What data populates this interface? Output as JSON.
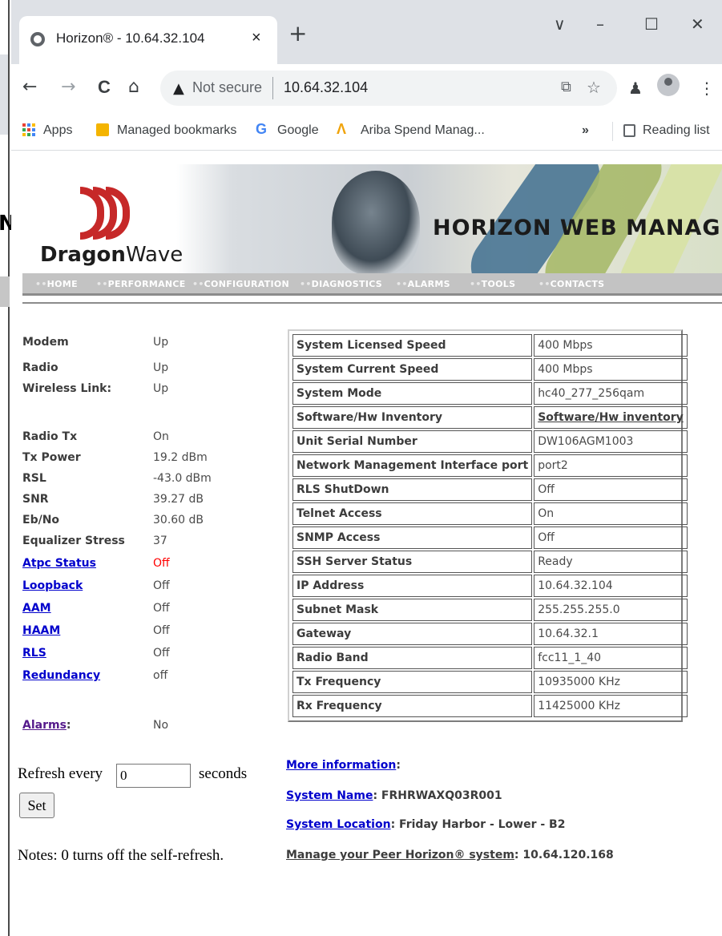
{
  "browser": {
    "tab_title": "Horizon® - 10.64.32.104",
    "tab_close": "×",
    "new_tab": "+",
    "window_controls": {
      "dropdown": "∨",
      "minimize": "–",
      "maximize": "☐",
      "close": "✕"
    },
    "nav": {
      "back": "←",
      "forward": "→",
      "reload": "C",
      "home": "⌂"
    },
    "omnibox": {
      "security_label": "Not secure",
      "url": "10.64.32.104"
    },
    "toolbar_icons": {
      "share": "⧉",
      "star": "☆",
      "extensions": "♟",
      "menu": "⋮"
    },
    "bookmarks": {
      "apps": "Apps",
      "managed": "Managed bookmarks",
      "google": "Google",
      "ariba": "Ariba Spend Manag...",
      "overflow": "»",
      "reading_list": "Reading list"
    }
  },
  "banner": {
    "logo_bold": "Dragon",
    "logo_light": "Wave",
    "title": "HORIZON WEB MANAGE"
  },
  "menu": [
    "HOME",
    "PERFORMANCE",
    "CONFIGURATION",
    "DIAGNOSTICS",
    "ALARMS",
    "TOOLS",
    "CONTACTS"
  ],
  "status": {
    "rows": [
      {
        "label": "Modem",
        "value": "Up"
      },
      {
        "label": "Radio",
        "value": "Up"
      },
      {
        "label": "Wireless Link:",
        "value": "Up"
      },
      {
        "label": "Radio Tx",
        "value": "On"
      },
      {
        "label": "Tx Power",
        "value": "19.2 dBm"
      },
      {
        "label": "RSL",
        "value": "-43.0 dBm"
      },
      {
        "label": "SNR",
        "value": "39.27 dB"
      },
      {
        "label": "Eb/No",
        "value": "30.60 dB"
      },
      {
        "label": "Equalizer Stress",
        "value": "37"
      },
      {
        "label": "Atpc Status",
        "value": "Off"
      },
      {
        "label": "Loopback",
        "value": "Off"
      },
      {
        "label": "AAM",
        "value": "Off"
      },
      {
        "label": "HAAM",
        "value": "Off"
      },
      {
        "label": "RLS",
        "value": "Off"
      },
      {
        "label": "Redundancy",
        "value": "off"
      },
      {
        "label": "Alarms",
        "label_suffix": ":",
        "value": "No"
      }
    ]
  },
  "refresh": {
    "label_before": "Refresh every",
    "value": "0",
    "label_after": "seconds",
    "button": "Set",
    "notes": "Notes: 0 turns off the self-refresh."
  },
  "info_table": [
    {
      "key": "System Licensed Speed",
      "value": "400 Mbps"
    },
    {
      "key": "System Current Speed",
      "value": "400 Mbps"
    },
    {
      "key": "System Mode",
      "value": "hc40_277_256qam"
    },
    {
      "key": "Software/Hw Inventory",
      "value": "Software/Hw inventory"
    },
    {
      "key": "Unit Serial Number",
      "value": "DW106AGM1003"
    },
    {
      "key": "Network Management Interface port",
      "value": "port2"
    },
    {
      "key": "RLS ShutDown",
      "value": "Off"
    },
    {
      "key": "Telnet Access",
      "value": "On"
    },
    {
      "key": "SNMP Access",
      "value": "Off"
    },
    {
      "key": "SSH Server Status",
      "value": "Ready"
    },
    {
      "key": "IP Address",
      "value": "10.64.32.104"
    },
    {
      "key": "Subnet Mask",
      "value": "255.255.255.0"
    },
    {
      "key": "Gateway",
      "value": "10.64.32.1"
    },
    {
      "key": "Radio Band",
      "value": "fcc11_1_40"
    },
    {
      "key": "Tx Frequency",
      "value": "10935000 KHz"
    },
    {
      "key": "Rx Frequency",
      "value": "11425000 KHz"
    }
  ],
  "more": {
    "more_info": "More information",
    "colon": ":",
    "system_name_label": "System Name",
    "system_name": " FRHRWAXQ03R001",
    "system_location_label": "System Location",
    "system_location": " Friday Harbor - Lower - B2",
    "peer_label": "Manage your Peer Horizon® system",
    "peer_value": " 10.64.120.168"
  },
  "colors": {
    "link": "#0000cc",
    "visited": "#551a8b",
    "alert": "#ff0000",
    "menubar": "#c3c3c3"
  }
}
